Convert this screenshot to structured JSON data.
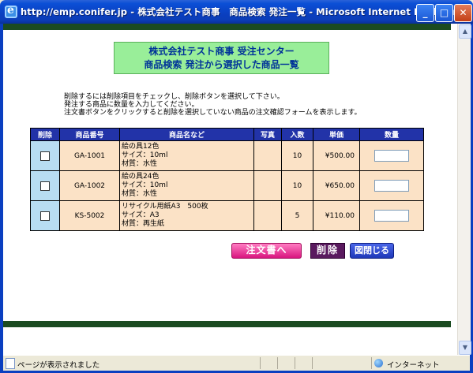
{
  "window": {
    "title": "http://emp.conifer.jp - 株式会社テスト商事　商品検索 発注一覧 - Microsoft Internet Explorer",
    "minimize": "_",
    "maximize": "□",
    "close": "✕"
  },
  "header": {
    "line1": "株式会社テスト商事 受注センター",
    "line2": "商品検索 発注から選択した商品一覧"
  },
  "instructions": [
    "削除するには削除項目をチェックし、削除ボタンを選択して下さい。",
    "発注する商品に数量を入力してください。",
    "注文書ボタンをクリックすると削除を選択していない商品の注文確認フォームを表示します。"
  ],
  "table": {
    "headers": [
      "削除",
      "商品番号",
      "商品名など",
      "写真",
      "入数",
      "単価",
      "数量"
    ],
    "rows": [
      {
        "code": "GA-1001",
        "name1": "絵の具12色",
        "name2": "サイズ：10ml",
        "name3": "材質：水性",
        "photo": "",
        "qty_per": "10",
        "price": "¥500.00",
        "qty": ""
      },
      {
        "code": "GA-1002",
        "name1": "絵の具24色",
        "name2": "サイズ：10ml",
        "name3": "材質：水性",
        "photo": "",
        "qty_per": "10",
        "price": "¥650.00",
        "qty": ""
      },
      {
        "code": "KS-5002",
        "name1": "リサイクル用紙A3　500枚",
        "name2": "サイズ：A3",
        "name3": "材質：再生紙",
        "photo": "",
        "qty_per": "5",
        "price": "¥110.00",
        "qty": ""
      }
    ]
  },
  "buttons": {
    "order": "注文書へ",
    "delete": "削除",
    "close": "図閉じる"
  },
  "status": {
    "left": "ページが表示されました",
    "right": "インターネット"
  },
  "colors": {
    "header_bg": "#99ee99",
    "header_text": "#003399",
    "table_head": "#2233a8",
    "row_bg": "#fbe2c6",
    "checkbox_cell": "#b8ddf2",
    "bar": "#1b4b21"
  }
}
